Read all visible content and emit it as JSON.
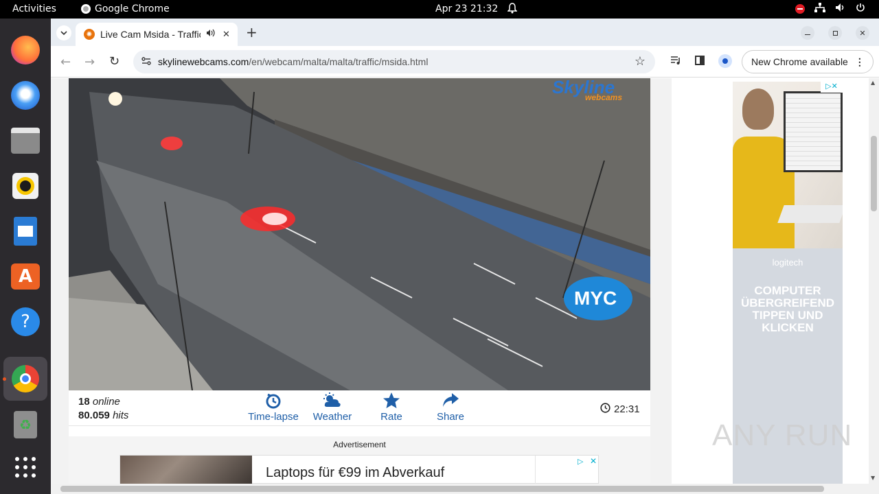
{
  "topbar": {
    "activities": "Activities",
    "app_name": "Google Chrome",
    "clock": "Apr 23  21:32"
  },
  "dock": {
    "items": [
      "firefox-icon",
      "thunderbird-icon",
      "files-icon",
      "rhythmbox-icon",
      "writer-icon",
      "software-icon",
      "help-icon",
      "chrome-icon",
      "trash-icon",
      "apps-grid-icon"
    ]
  },
  "browser": {
    "tab_title": "Live Cam Msida - Traffic",
    "url_host": "skylinewebcams.com",
    "url_path": "/en/webcam/malta/malta/traffic/msida.html",
    "update_label": "New Chrome available"
  },
  "cam": {
    "brand": "Skyline",
    "brand_sub": "webcams",
    "sponsor_logo": "MYC"
  },
  "stats": {
    "online_count": "18",
    "online_label": "online",
    "hits_count": "80.059",
    "hits_label": "hits",
    "actions": [
      "Time-lapse",
      "Weather",
      "Rate",
      "Share"
    ],
    "local_time": "22:31"
  },
  "ad": {
    "label": "Advertisement",
    "headline": "Laptops für €99 im Abverkauf"
  },
  "side_ad": {
    "brand": "logitech",
    "text": "COMPUTER ÜBERGREIFEND TIPPEN UND KLICKEN"
  },
  "watermark": "ANY RUN",
  "colors": {
    "link_blue": "#1f5fa8",
    "dock_bg": "#2c2a2e",
    "side_ad_bg": "#d4d9e0"
  }
}
